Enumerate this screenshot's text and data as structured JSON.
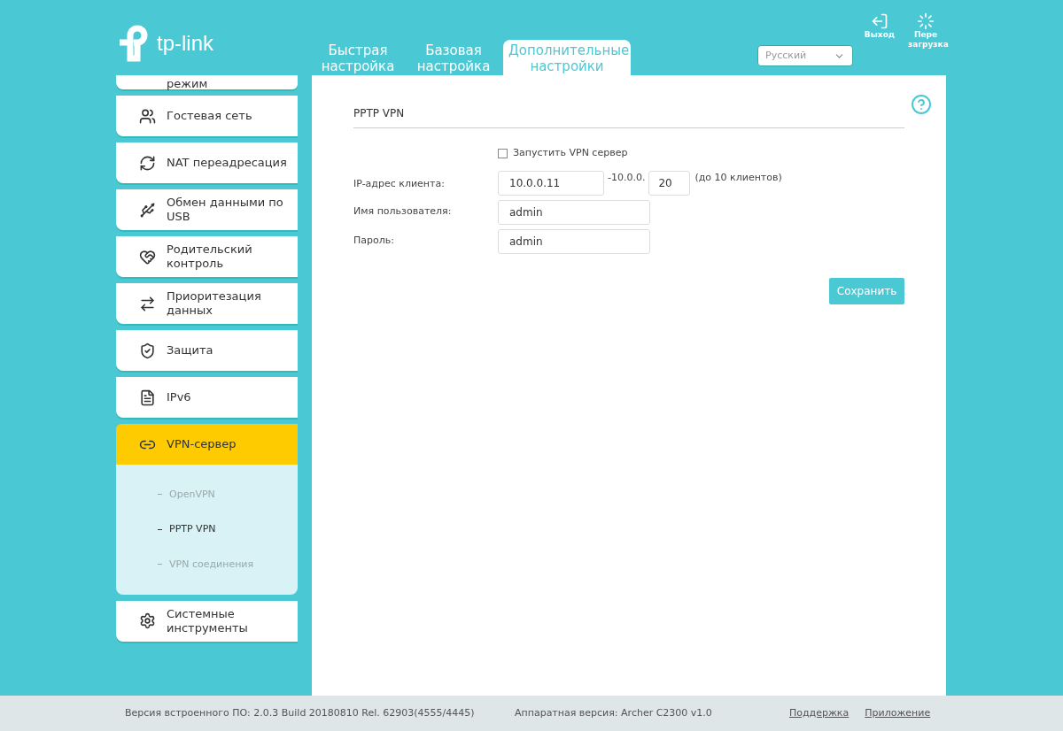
{
  "header": {
    "brand": "tp-link",
    "tabs": [
      {
        "label": "Быстрая настройка",
        "selected": false
      },
      {
        "label": "Базовая настройка",
        "selected": false
      },
      {
        "label": "Дополнительные настройки",
        "selected": true
      }
    ],
    "language": "Русский",
    "actions": [
      {
        "label": "Выход"
      },
      {
        "label": "Пере загрузка"
      }
    ]
  },
  "sidebar": {
    "items": [
      {
        "label": "режим",
        "selected": false
      },
      {
        "label": "Гостевая сеть",
        "selected": false
      },
      {
        "label": "NAT переадресация",
        "selected": false
      },
      {
        "label": "Обмен данными по USB",
        "selected": false
      },
      {
        "label": "Родительский контроль",
        "selected": false
      },
      {
        "label": "Приоритезация данных",
        "selected": false
      },
      {
        "label": "Защита",
        "selected": false
      },
      {
        "label": "IPv6",
        "selected": false
      },
      {
        "label": "VPN-сервер",
        "selected": true,
        "children": [
          {
            "label": "OpenVPN",
            "selected": false
          },
          {
            "label": "PPTP VPN",
            "selected": true
          },
          {
            "label": "VPN соединения",
            "selected": false
          }
        ]
      },
      {
        "label": "Системные инструменты",
        "selected": false
      }
    ]
  },
  "form": {
    "title": "PPTP VPN",
    "enable": {
      "label": "Запустить VPN сервер",
      "checked": false
    },
    "ip": {
      "label": "IP-адрес клиента:",
      "start": "10.0.0.11",
      "separator": "-10.0.0.",
      "end": "20",
      "note": "(до 10 клиентов)"
    },
    "username": {
      "label": "Имя пользователя:",
      "value": "admin"
    },
    "password": {
      "label": "Пароль:",
      "value": "admin"
    },
    "save": "Сохранить"
  },
  "footer": {
    "firmware": "Версия встроенного ПО: 2.0.3 Build 20180810 Rel. 62903(4555/4445)",
    "hardware": "Аппаратная версия: Archer C2300 v1.0",
    "links": [
      "Поддержка",
      "Приложение"
    ]
  }
}
